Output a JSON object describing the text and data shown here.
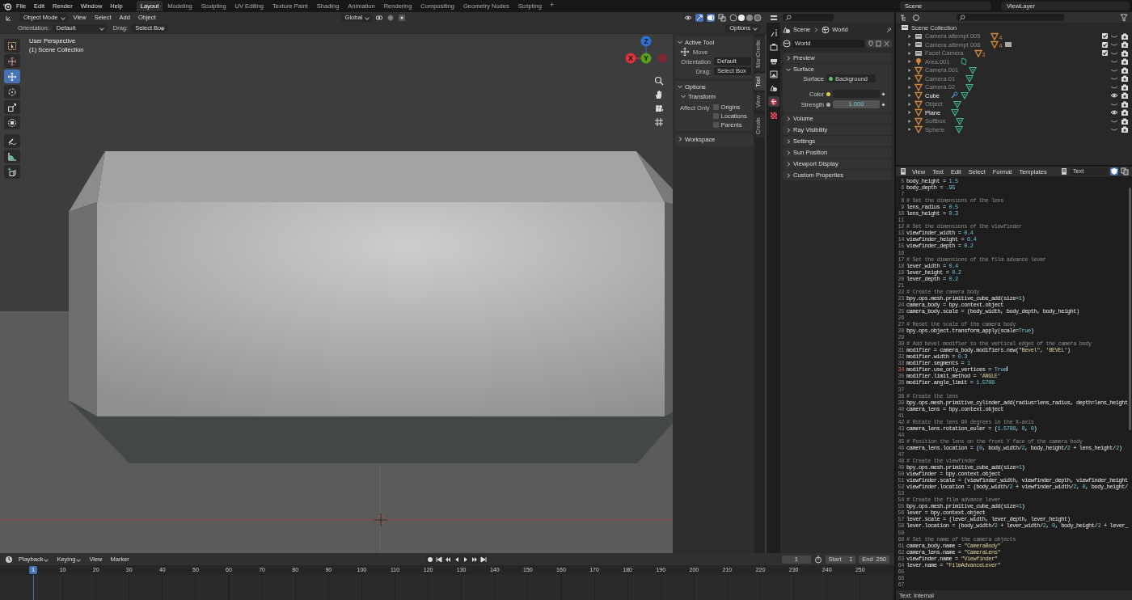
{
  "topbar": {
    "menus": [
      "File",
      "Edit",
      "Render",
      "Window",
      "Help"
    ],
    "workspaces": [
      {
        "label": "Layout",
        "selected": true
      },
      {
        "label": "Modeling",
        "selected": false
      },
      {
        "label": "Sculpting",
        "selected": false
      },
      {
        "label": "UV Editing",
        "selected": false
      },
      {
        "label": "Texture Paint",
        "selected": false
      },
      {
        "label": "Shading",
        "selected": false
      },
      {
        "label": "Animation",
        "selected": false
      },
      {
        "label": "Rendering",
        "selected": false
      },
      {
        "label": "Compositing",
        "selected": false
      },
      {
        "label": "Geometry Nodes",
        "selected": false
      },
      {
        "label": "Scripting",
        "selected": false
      }
    ],
    "add_tab": "+",
    "scene": "Scene",
    "view_layer": "ViewLayer"
  },
  "viewport": {
    "mode": "Object Mode",
    "menus": [
      "View",
      "Select",
      "Add",
      "Object"
    ],
    "orientation": "Global",
    "options": "Options",
    "tool_settings": {
      "orientation_label": "Orientation:",
      "orientation": "Default",
      "drag_label": "Drag:",
      "drag": "Select Box"
    },
    "overlay": [
      "User Perspective",
      "(1) Scene Collection"
    ],
    "tools": [
      {
        "kind": "select-box",
        "selected": false
      },
      {
        "kind": "cursor",
        "selected": false
      },
      {
        "kind": "move",
        "selected": true
      },
      {
        "kind": "rotate",
        "selected": false
      },
      {
        "kind": "scale",
        "selected": false
      },
      {
        "kind": "transform",
        "selected": false
      },
      {
        "kind": "annotate",
        "selected": false
      },
      {
        "kind": "measure",
        "selected": false
      },
      {
        "kind": "add-cube",
        "selected": false
      }
    ],
    "gizmo_axes": [
      {
        "label": "Z",
        "color": "#2f6fd6"
      },
      {
        "label": "X",
        "color": "#d9343f"
      },
      {
        "label": "Y",
        "color": "#5a9e1a"
      }
    ]
  },
  "sidebar": {
    "tabs": [
      {
        "label": "MariOnette",
        "selected": false
      },
      {
        "label": "Tool",
        "selected": true
      },
      {
        "label": "View",
        "selected": false
      },
      {
        "label": "Create",
        "selected": false
      }
    ],
    "active_tool": {
      "title": "Active Tool",
      "expanded": true,
      "tool": "Move",
      "orientation_label": "Orientation",
      "orientation": "Default",
      "drag_label": "Drag:",
      "drag": "Select Box"
    },
    "options": {
      "title": "Options",
      "expanded": true,
      "transform_title": "Transform",
      "transform_expanded": true,
      "affect_label": "Affect Only",
      "checkboxes": [
        {
          "label": "Origins",
          "checked": false
        },
        {
          "label": "Locations",
          "checked": false
        },
        {
          "label": "Parents",
          "checked": false
        }
      ]
    },
    "workspace": {
      "title": "Workspace",
      "expanded": false
    }
  },
  "properties": {
    "tabs": [
      {
        "kind": "tool",
        "selected": false
      },
      {
        "kind": "render",
        "selected": false
      },
      {
        "kind": "output",
        "selected": false
      },
      {
        "kind": "view-layer",
        "selected": false
      },
      {
        "kind": "scene",
        "selected": false
      },
      {
        "kind": "world",
        "selected": true
      },
      {
        "kind": "texture",
        "selected": false
      }
    ],
    "breadcrumb": [
      "Scene",
      "World"
    ],
    "world": "World",
    "panels": [
      {
        "title": "Preview",
        "expanded": false
      },
      {
        "title": "Surface",
        "expanded": true
      },
      {
        "title": "Volume",
        "expanded": false
      },
      {
        "title": "Ray Visibility",
        "expanded": false
      },
      {
        "title": "Settings",
        "expanded": false
      },
      {
        "title": "Sun Position",
        "expanded": false
      },
      {
        "title": "Viewport Display",
        "expanded": false
      },
      {
        "title": "Custom Properties",
        "expanded": false
      }
    ],
    "surface": {
      "surface_label": "Surface",
      "surface_value": "Background",
      "color_label": "Color",
      "strength_label": "Strength",
      "strength": "1.000"
    }
  },
  "outliner": {
    "root": "Scene Collection",
    "rows": [
      {
        "kind": "collection",
        "name": "Camera attempt 005",
        "visible": false,
        "checked": true,
        "badges": [
          {
            "kind": "objects",
            "count": "4"
          }
        ]
      },
      {
        "kind": "collection",
        "name": "Camera attempt 006",
        "visible": false,
        "checked": true,
        "badges": [
          {
            "kind": "objects",
            "count": "4"
          },
          {
            "kind": "collection"
          }
        ]
      },
      {
        "kind": "collection",
        "name": "Facet Camera",
        "visible": false,
        "checked": true,
        "badges": [
          {
            "kind": "objects",
            "count": "3"
          }
        ]
      },
      {
        "kind": "light",
        "name": "Area.001",
        "visible": false,
        "checked": false,
        "badges": [
          {
            "kind": "light-data"
          }
        ]
      },
      {
        "kind": "mesh",
        "name": "Camera.001",
        "visible": false,
        "checked": false,
        "badges": [
          {
            "kind": "mesh-data"
          }
        ]
      },
      {
        "kind": "mesh",
        "name": "Camera 01",
        "visible": false,
        "checked": false,
        "badges": [
          {
            "kind": "mesh-data"
          }
        ]
      },
      {
        "kind": "mesh",
        "name": "Camera 02",
        "visible": false,
        "checked": false,
        "badges": [
          {
            "kind": "mesh-data"
          }
        ]
      },
      {
        "kind": "mesh",
        "name": "Cube",
        "visible": true,
        "checked": false,
        "badges": [
          {
            "kind": "modifier"
          },
          {
            "kind": "mesh-data"
          }
        ]
      },
      {
        "kind": "mesh",
        "name": "Object",
        "visible": false,
        "checked": false,
        "badges": [
          {
            "kind": "mesh-data"
          }
        ]
      },
      {
        "kind": "mesh",
        "name": "Plane",
        "visible": true,
        "checked": false,
        "badges": [
          {
            "kind": "mesh-data"
          }
        ]
      },
      {
        "kind": "mesh",
        "name": "Softbox",
        "visible": false,
        "checked": false,
        "badges": [
          {
            "kind": "mesh-data"
          }
        ]
      },
      {
        "kind": "mesh",
        "name": "Sphere",
        "visible": false,
        "checked": false,
        "badges": [
          {
            "kind": "mesh-data"
          }
        ]
      }
    ]
  },
  "text_editor": {
    "menus": [
      "View",
      "Text",
      "Edit",
      "Select",
      "Format",
      "Templates"
    ],
    "datablock": "Text",
    "status": "Text: Internal",
    "lines": [
      {
        "n": "5",
        "kind": "code",
        "current": false,
        "text": "body_height = 1.5"
      },
      {
        "n": "6",
        "kind": "code",
        "current": false,
        "text": "body_depth = .95"
      },
      {
        "n": "7",
        "kind": "blank",
        "current": false
      },
      {
        "n": "8",
        "kind": "comment",
        "current": false,
        "text": "# Set the dimensions of the lens"
      },
      {
        "n": "9",
        "kind": "code",
        "current": false,
        "text": "lens_radius = 0.5"
      },
      {
        "n": "10",
        "kind": "code",
        "current": false,
        "text": "lens_height = 0.3"
      },
      {
        "n": "11",
        "kind": "blank",
        "current": false
      },
      {
        "n": "12",
        "kind": "comment",
        "current": false,
        "text": "# Set the dimensions of the viewfinder"
      },
      {
        "n": "13",
        "kind": "code",
        "current": false,
        "text": "viewfinder_width = 0.4"
      },
      {
        "n": "14",
        "kind": "code",
        "current": false,
        "text": "viewfinder_height = 0.4"
      },
      {
        "n": "15",
        "kind": "code",
        "current": false,
        "text": "viewfinder_depth = 0.2"
      },
      {
        "n": "16",
        "kind": "blank",
        "current": false
      },
      {
        "n": "17",
        "kind": "comment",
        "current": false,
        "text": "# Set the dimensions of the film advance lever"
      },
      {
        "n": "18",
        "kind": "code",
        "current": false,
        "text": "lever_width = 0.4"
      },
      {
        "n": "19",
        "kind": "code",
        "current": false,
        "text": "lever_height = 0.2"
      },
      {
        "n": "20",
        "kind": "code",
        "current": false,
        "text": "lever_depth = 0.2"
      },
      {
        "n": "21",
        "kind": "blank",
        "current": false
      },
      {
        "n": "22",
        "kind": "comment",
        "current": false,
        "text": "# Create the camera body"
      },
      {
        "n": "23",
        "kind": "code",
        "current": false,
        "text": "bpy.ops.mesh.primitive_cube_add(size=1)"
      },
      {
        "n": "24",
        "kind": "code",
        "current": false,
        "text": "camera_body = bpy.context.object"
      },
      {
        "n": "25",
        "kind": "code",
        "current": false,
        "text": "camera_body.scale = (body_width, body_depth, body_height)"
      },
      {
        "n": "26",
        "kind": "blank",
        "current": false
      },
      {
        "n": "27",
        "kind": "comment",
        "current": false,
        "text": "# Reset the scale of the camera body"
      },
      {
        "n": "28",
        "kind": "code",
        "current": false,
        "text": "bpy.ops.object.transform_apply(scale=True)"
      },
      {
        "n": "29",
        "kind": "blank",
        "current": false
      },
      {
        "n": "30",
        "kind": "comment",
        "current": false,
        "text": "# Add bevel modifier to the vertical edges of the camera body"
      },
      {
        "n": "31",
        "kind": "code",
        "current": false,
        "text": "modifier = camera_body.modifiers.new(\"Bevel\", 'BEVEL')"
      },
      {
        "n": "32",
        "kind": "code",
        "current": false,
        "text": "modifier.width = 0.3"
      },
      {
        "n": "33",
        "kind": "code",
        "current": false,
        "text": "modifier.segments = 1"
      },
      {
        "n": "34",
        "kind": "code",
        "current": true,
        "text": "modifier.use_only_vertices = True"
      },
      {
        "n": "35",
        "kind": "code",
        "current": false,
        "text": "modifier.limit_method = 'ANGLE'"
      },
      {
        "n": "36",
        "kind": "code",
        "current": false,
        "text": "modifier.angle_limit = 1.5708"
      },
      {
        "n": "37",
        "kind": "blank",
        "current": false
      },
      {
        "n": "38",
        "kind": "comment",
        "current": false,
        "text": "# Create the lens"
      },
      {
        "n": "39",
        "kind": "code",
        "current": false,
        "text": "bpy.ops.mesh.primitive_cylinder_add(radius=lens_radius, depth=lens_height"
      },
      {
        "n": "40",
        "kind": "code",
        "current": false,
        "text": "camera_lens = bpy.context.object"
      },
      {
        "n": "41",
        "kind": "blank",
        "current": false
      },
      {
        "n": "42",
        "kind": "comment",
        "current": false,
        "text": "# Rotate the lens 90 degrees in the X-axis"
      },
      {
        "n": "43",
        "kind": "code",
        "current": false,
        "text": "camera_lens.rotation_euler = (1.5708, 0, 0)"
      },
      {
        "n": "44",
        "kind": "blank",
        "current": false
      },
      {
        "n": "45",
        "kind": "comment",
        "current": false,
        "text": "# Position the lens on the front Y face of the camera body"
      },
      {
        "n": "46",
        "kind": "code",
        "current": false,
        "text": "camera_lens.location = (0, body_width/2, body_height/2 + lens_height/2)"
      },
      {
        "n": "47",
        "kind": "blank",
        "current": false
      },
      {
        "n": "48",
        "kind": "comment",
        "current": false,
        "text": "# Create the viewfinder"
      },
      {
        "n": "49",
        "kind": "code",
        "current": false,
        "text": "bpy.ops.mesh.primitive_cube_add(size=1)"
      },
      {
        "n": "50",
        "kind": "code",
        "current": false,
        "text": "viewfinder = bpy.context.object"
      },
      {
        "n": "51",
        "kind": "code",
        "current": false,
        "text": "viewfinder.scale = (viewfinder_width, viewfinder_depth, viewfinder_height"
      },
      {
        "n": "52",
        "kind": "code",
        "current": false,
        "text": "viewfinder.location = (body_width/2 + viewfinder_width/2, 0, body_height/"
      },
      {
        "n": "53",
        "kind": "blank",
        "current": false
      },
      {
        "n": "54",
        "kind": "comment",
        "current": false,
        "text": "# Create the film advance lever"
      },
      {
        "n": "55",
        "kind": "code",
        "current": false,
        "text": "bpy.ops.mesh.primitive_cube_add(size=1)"
      },
      {
        "n": "56",
        "kind": "code",
        "current": false,
        "text": "lever = bpy.context.object"
      },
      {
        "n": "57",
        "kind": "code",
        "current": false,
        "text": "lever.scale = (lever_width, lever_depth, lever_height)"
      },
      {
        "n": "58",
        "kind": "code",
        "current": false,
        "text": "lever.location = (body_width/2 + lever_width/2, 0, body_height/2 + lever_"
      },
      {
        "n": "59",
        "kind": "blank",
        "current": false
      },
      {
        "n": "60",
        "kind": "comment",
        "current": false,
        "text": "# Set the name of the camera objects"
      },
      {
        "n": "61",
        "kind": "code",
        "current": false,
        "text": "camera_body.name = \"CameraBody\""
      },
      {
        "n": "62",
        "kind": "code",
        "current": false,
        "text": "camera_lens.name = \"CameraLens\""
      },
      {
        "n": "63",
        "kind": "code",
        "current": false,
        "text": "viewfinder.name = \"Viewfinder\""
      },
      {
        "n": "64",
        "kind": "code",
        "current": false,
        "text": "lever.name = \"FilmAdvanceLever\""
      },
      {
        "n": "65",
        "kind": "blank",
        "current": false
      },
      {
        "n": "66",
        "kind": "blank",
        "current": false
      },
      {
        "n": "67",
        "kind": "blank",
        "current": false
      }
    ]
  },
  "timeline": {
    "menus": [
      "Playback",
      "Keying",
      "View",
      "Marker"
    ],
    "current_frame": "1",
    "start_label": "Start",
    "start": "1",
    "end_label": "End",
    "end": "250",
    "playhead": "1",
    "ticks": [
      "10",
      "20",
      "30",
      "40",
      "50",
      "60",
      "70",
      "80",
      "90",
      "100",
      "110",
      "120",
      "130",
      "140",
      "150",
      "160",
      "170",
      "180",
      "190",
      "200",
      "210",
      "220",
      "230",
      "240",
      "250"
    ]
  }
}
